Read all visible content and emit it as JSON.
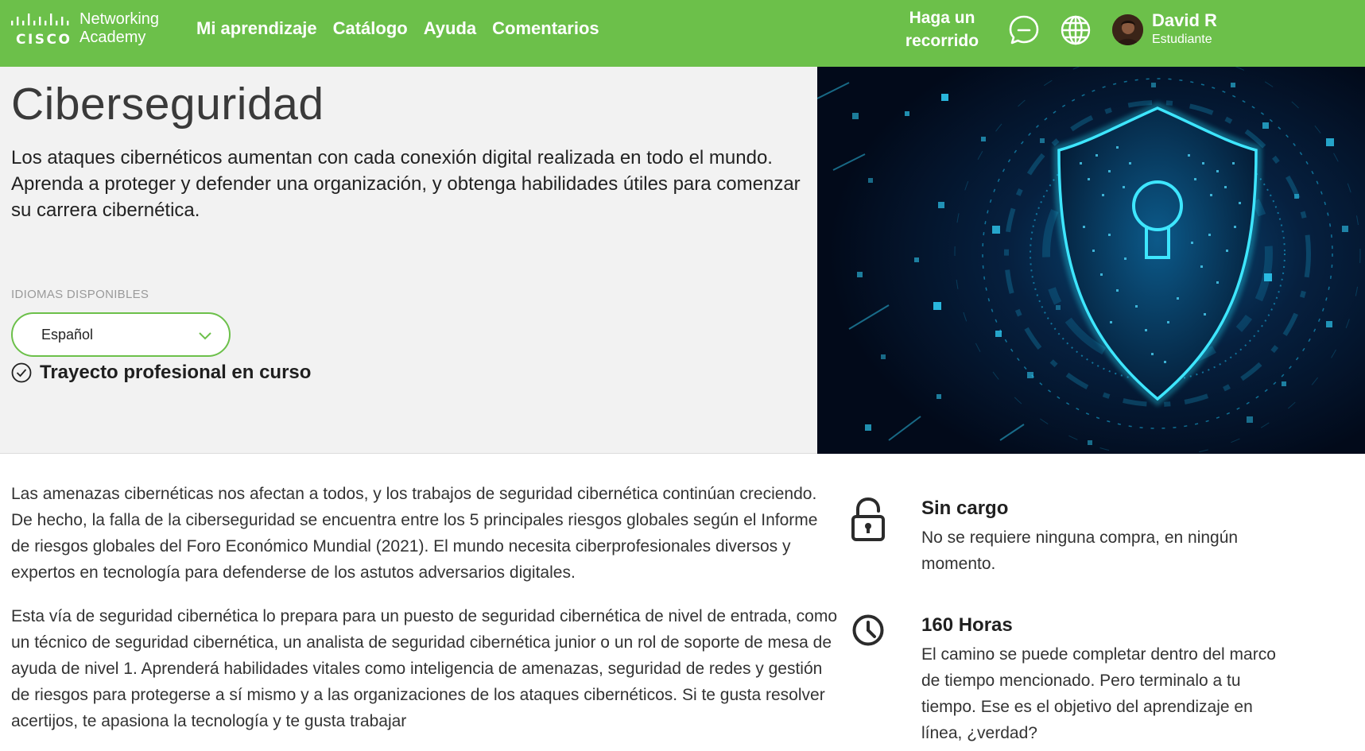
{
  "brand": {
    "cisco_label": "CISCO",
    "product_line1": "Networking",
    "product_line2": "Academy"
  },
  "nav": {
    "items": [
      {
        "label": "Mi aprendizaje"
      },
      {
        "label": "Catálogo"
      },
      {
        "label": "Ayuda"
      },
      {
        "label": "Comentarios"
      }
    ],
    "tour_line1": "Haga un",
    "tour_line2": "recorrido",
    "icons": [
      "chat-icon",
      "globe-icon"
    ]
  },
  "user": {
    "name": "David R",
    "role": "Estudiante"
  },
  "hero": {
    "title": "Ciberseguridad",
    "description": "Los ataques cibernéticos aumentan con cada conexión digital realizada en todo el mundo. Aprenda a proteger y defender una organización, y obtenga habilidades útiles para comenzar su carrera cibernética.",
    "languages_label": "IDIOMAS DISPONIBLES",
    "selected_language": "Español",
    "status": "Trayecto profesional en curso"
  },
  "content": {
    "paragraphs": [
      "Las amenazas cibernéticas nos afectan a todos, y los trabajos de seguridad cibernética continúan creciendo. De hecho, la falla de la ciberseguridad se encuentra entre los 5 principales riesgos globales según el Informe de riesgos globales del Foro Económico Mundial (2021). El mundo necesita ciberprofesionales diversos y expertos en tecnología para defenderse de los astutos adversarios digitales.",
      "Esta vía de seguridad cibernética lo prepara para un puesto de seguridad cibernética de nivel de entrada, como un técnico de seguridad cibernética, un analista de seguridad cibernética junior o un rol de soporte de mesa de ayuda de nivel 1. Aprenderá habilidades vitales como inteligencia de amenazas, seguridad de redes y gestión de riesgos para protegerse a sí mismo y a las organizaciones de los ataques cibernéticos. Si te gusta resolver acertijos, te apasiona la tecnología y te gusta trabajar"
    ]
  },
  "features": [
    {
      "icon": "unlock-icon",
      "title": "Sin cargo",
      "description": "No se requiere ninguna compra, en ningún momento."
    },
    {
      "icon": "clock-icon",
      "title": "160 Horas",
      "description": "El camino se puede completar dentro del marco de tiempo mencionado. Pero terminalo a tu tiempo. Ese es el objetivo del aprendizaje en línea, ¿verdad?"
    }
  ],
  "colors": {
    "nav_green": "#6cc04a",
    "hero_bg": "#f2f2f2",
    "cyber_cyan": "#22d3ee"
  }
}
